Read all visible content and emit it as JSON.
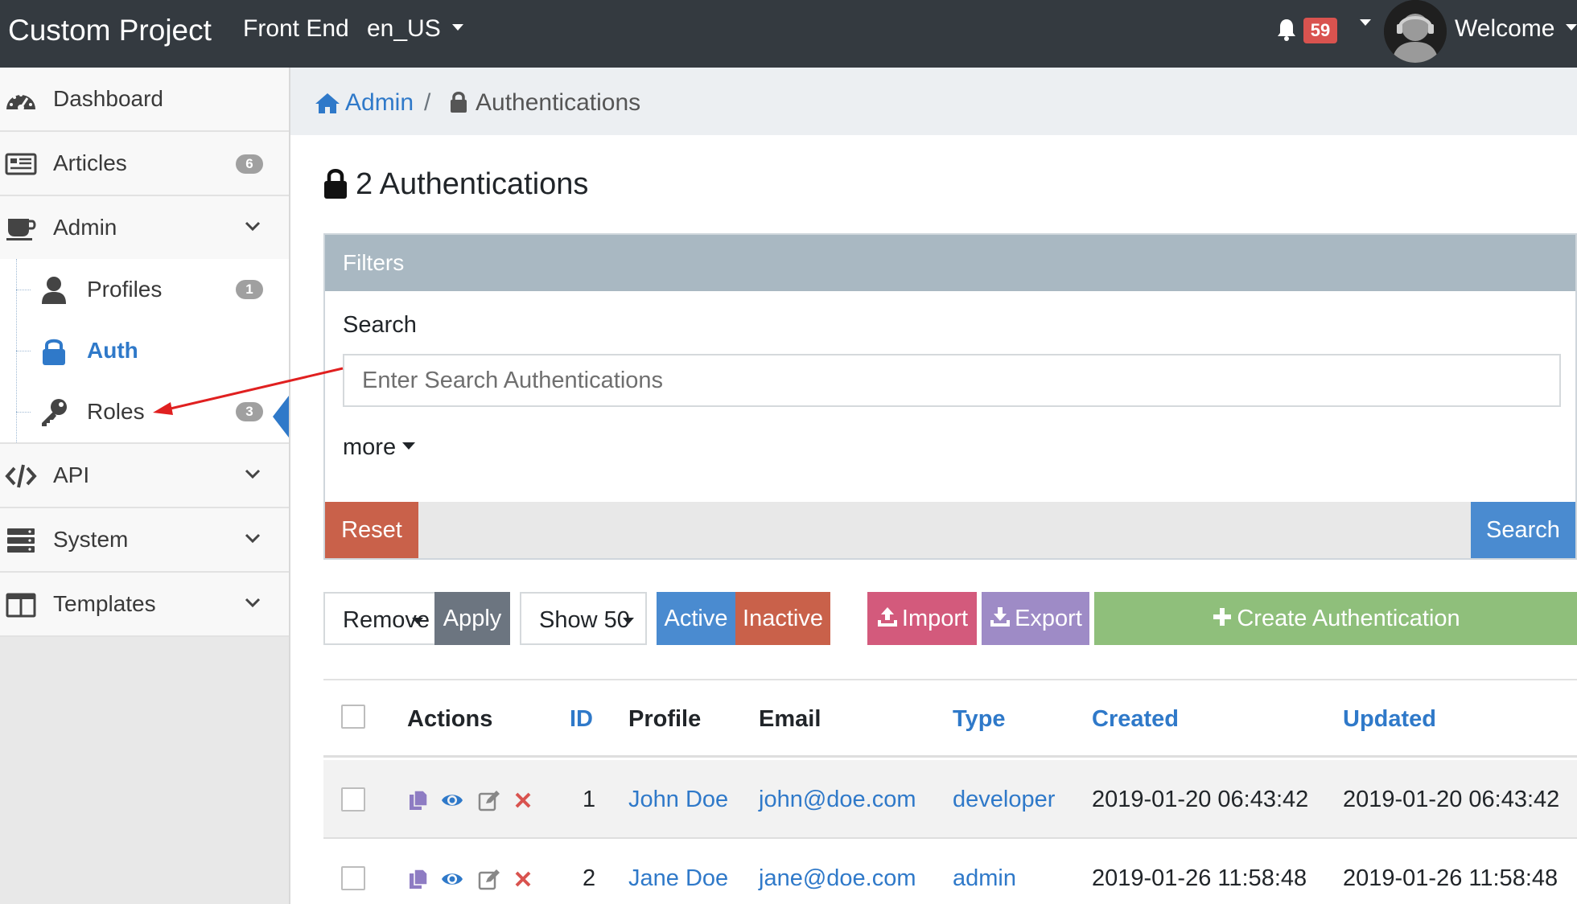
{
  "topbar": {
    "brand": "Custom Project",
    "front_end": "Front End",
    "language": "en_US",
    "notification_count": "59",
    "welcome": "Welcome"
  },
  "sidebar": {
    "items": [
      {
        "label": "Dashboard",
        "icon": "dashboard-icon"
      },
      {
        "label": "Articles",
        "badge": "6",
        "icon": "newspaper-icon"
      },
      {
        "label": "Admin",
        "icon": "coffee-icon",
        "expanded": true
      },
      {
        "label": "API",
        "icon": "code-icon"
      },
      {
        "label": "System",
        "icon": "server-icon"
      },
      {
        "label": "Templates",
        "icon": "columns-icon"
      }
    ],
    "admin_children": [
      {
        "label": "Profiles",
        "badge": "1",
        "icon": "user-icon"
      },
      {
        "label": "Auth",
        "icon": "lock-icon",
        "active": true
      },
      {
        "label": "Roles",
        "badge": "3",
        "icon": "key-icon"
      }
    ]
  },
  "breadcrumb": {
    "admin": "Admin",
    "separator": "/",
    "current": "Authentications"
  },
  "page": {
    "title": "2 Authentications"
  },
  "filters": {
    "heading": "Filters",
    "search_label": "Search",
    "search_placeholder": "Enter Search Authentications",
    "more": "more",
    "reset": "Reset",
    "search_button": "Search"
  },
  "toolbar": {
    "bulk_action": "Remove",
    "apply": "Apply",
    "page_size": "Show 50",
    "active": "Active",
    "inactive": "Inactive",
    "import": "Import",
    "export": "Export",
    "create": "Create Authentication"
  },
  "table": {
    "columns": {
      "actions": "Actions",
      "id": "ID",
      "profile": "Profile",
      "email": "Email",
      "type": "Type",
      "created": "Created",
      "updated": "Updated"
    },
    "rows": [
      {
        "id": "1",
        "profile": "John Doe",
        "email": "john@doe.com",
        "type": "developer",
        "created": "2019-01-20 06:43:42",
        "updated": "2019-01-20 06:43:42"
      },
      {
        "id": "2",
        "profile": "Jane Doe",
        "email": "jane@doe.com",
        "type": "admin",
        "created": "2019-01-26 11:58:48",
        "updated": "2019-01-26 11:58:48"
      }
    ]
  },
  "colors": {
    "navbar": "#343a40",
    "link": "#2f79c9",
    "danger": "#c9614a",
    "primary": "#4a8bd0",
    "import": "#d35a7c",
    "export": "#9e8bc6",
    "create": "#8fbf7b",
    "annotation_arrow": "#e02020"
  }
}
